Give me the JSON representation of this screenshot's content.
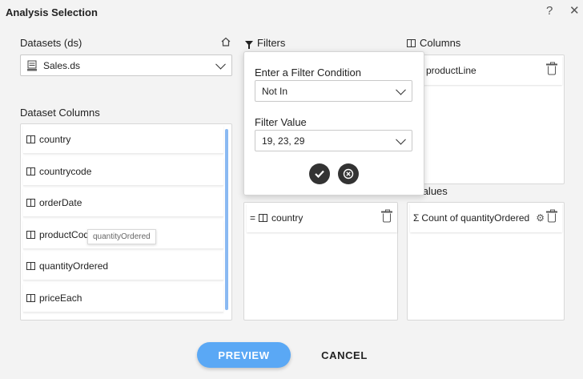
{
  "dialog": {
    "title": "Analysis Selection",
    "help": "?",
    "close": "✕"
  },
  "datasets": {
    "label": "Datasets (ds)",
    "selected": "Sales.ds"
  },
  "dataset_columns": {
    "label": "Dataset Columns",
    "items": [
      "country",
      "countrycode",
      "orderDate",
      "productCode",
      "quantityOrdered",
      "priceEach"
    ],
    "tooltip": "quantityOrdered"
  },
  "filters": {
    "label": "Filters",
    "popover": {
      "condition_label": "Enter a Filter Condition",
      "condition_value": "Not In",
      "value_label": "Filter Value",
      "value_value": "19, 23, 29",
      "confirm_icon": "check-icon",
      "cancel_icon": "cancel-circle-icon"
    },
    "chip": {
      "prefix": "=",
      "label": "country"
    }
  },
  "columns": {
    "label": "Columns",
    "chip": {
      "label": "productLine"
    }
  },
  "values": {
    "label": "Values",
    "chip": {
      "prefix": "Σ",
      "label": "Count of quantityOrdered"
    }
  },
  "buttons": {
    "preview": "PREVIEW",
    "cancel": "CANCEL"
  },
  "colors": {
    "accent": "#5aa8f5",
    "scrollbar": "#8ab9f2"
  }
}
